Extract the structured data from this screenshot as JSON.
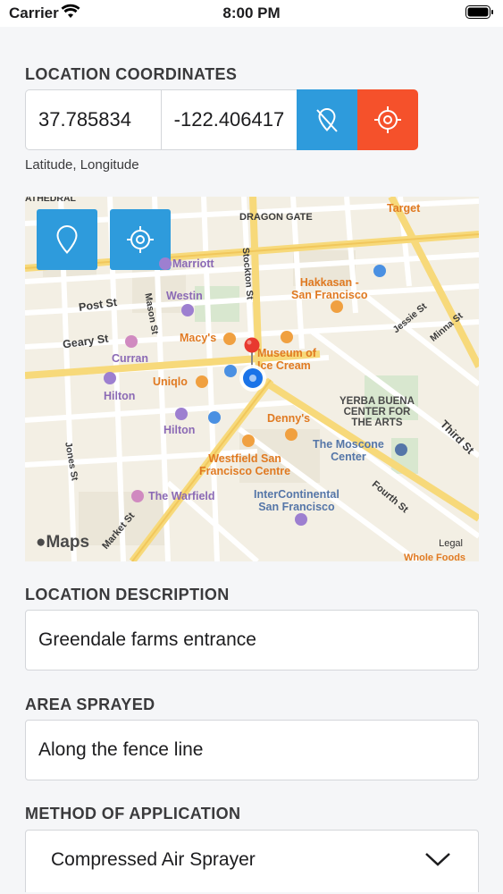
{
  "status_bar": {
    "carrier": "Carrier",
    "time": "8:00 PM"
  },
  "coordinates": {
    "section_label": "LOCATION COORDINATES",
    "latitude": "37.785834",
    "longitude": "-122.406417",
    "hint": "Latitude, Longitude",
    "clear_button_icon": "location-off-icon",
    "locate_button_icon": "crosshair-icon"
  },
  "map": {
    "pin_button_icon": "map-pin-icon",
    "locate_button_icon": "crosshair-icon",
    "labels": {
      "athedral": "ATHEDRAL",
      "dragon_gate": "DRAGON GATE",
      "target": "Target",
      "marriott": "Marriott",
      "hakkasan": "Hakkasan -\nSan Francisco",
      "westin": "Westin",
      "post_st": "Post St",
      "macys": "Macy's",
      "museum": "Museum of\nIce Cream",
      "geary_st": "Geary St",
      "curran": "Curran",
      "uniqlo": "Uniqlo",
      "hilton_1": "Hilton",
      "hilton_2": "Hilton",
      "yerba_buena": "YERBA BUENA\nCENTER FOR\nTHE ARTS",
      "dennys": "Denny's",
      "westfield": "Westfield San\nFrancisco Centre",
      "moscone": "The Moscone\nCenter",
      "third_st": "Third St",
      "warfield": "The Warfield",
      "intercontinental": "InterContinental\nSan Francisco",
      "fourth_st": "Fourth St",
      "market_st": "Market St",
      "jones_st": "Jones St",
      "mason_st": "Mason St",
      "stockton_st": "Stockton St",
      "jessie_st": "Jessie St",
      "minna_st": "Minna St",
      "whole_foods": "Whole Foods"
    },
    "logo": "Maps",
    "legal": "Legal"
  },
  "location_description": {
    "section_label": "LOCATION DESCRIPTION",
    "value": "Greendale farms entrance"
  },
  "area_sprayed": {
    "section_label": "AREA SPRAYED",
    "value": "Along the fence line"
  },
  "method_of_application": {
    "section_label": "METHOD OF APPLICATION",
    "selected": "Compressed Air Sprayer"
  },
  "colors": {
    "accent_blue": "#2e9bdc",
    "accent_red": "#f5512b",
    "pin_red": "#e8392f"
  }
}
